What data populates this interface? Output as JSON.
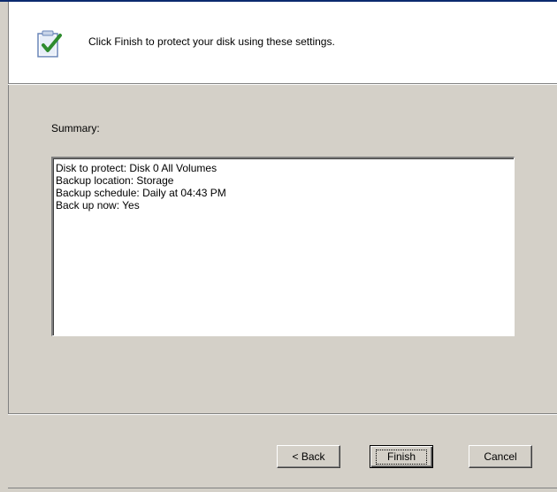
{
  "header": {
    "icon": "checklist-icon",
    "instruction": "Click Finish to protect your disk using these settings."
  },
  "summary": {
    "label": "Summary:",
    "lines": [
      "Disk to protect: Disk 0 All Volumes",
      "Backup location: Storage",
      "Backup schedule: Daily at 04:43 PM",
      "Back up now: Yes"
    ]
  },
  "buttons": {
    "back": "< Back",
    "finish": "Finish",
    "cancel": "Cancel"
  },
  "colors": {
    "dialog_bg": "#d4d0c8",
    "header_bg": "#ffffff",
    "check_green": "#2e8b2e"
  }
}
